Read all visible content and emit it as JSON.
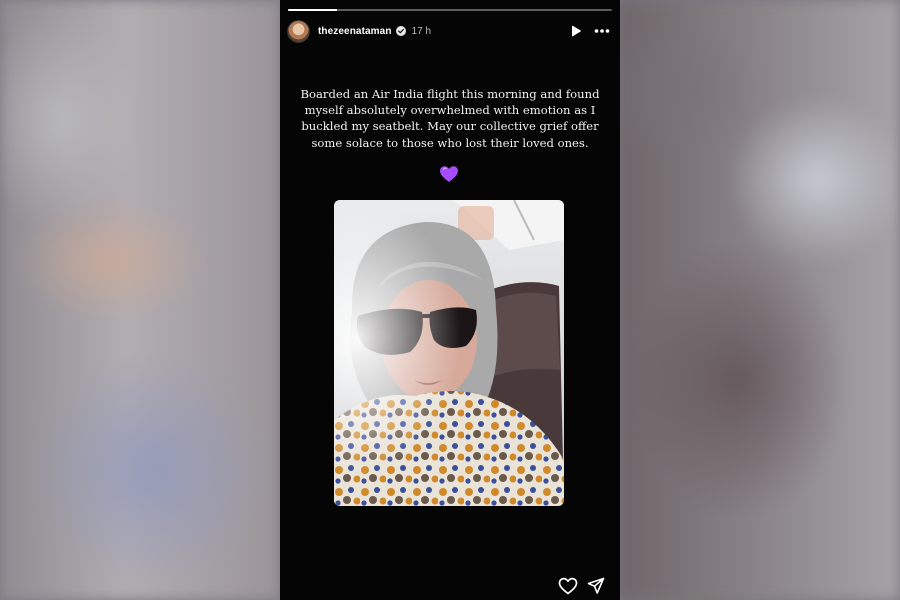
{
  "story": {
    "username": "thezeenataman",
    "time_ago": "17 h",
    "progress": 0.15,
    "caption": "Boarded an Air India flight this morning and found myself absolutely overwhelmed with emotion as I buckled my seatbelt. May our collective grief offer some solace to those who lost their loved ones.",
    "emoji": "purple-heart-icon"
  },
  "colors": {
    "story_background": "#050505",
    "text": "#f2f2f2",
    "emoji_purple": "#a64dff"
  },
  "icons": {
    "avatar": "avatar",
    "verified": "verified-badge-icon",
    "play": "play-icon",
    "more": "more-options-icon",
    "like": "heart-outline-icon",
    "share": "send-paper-plane-icon"
  }
}
